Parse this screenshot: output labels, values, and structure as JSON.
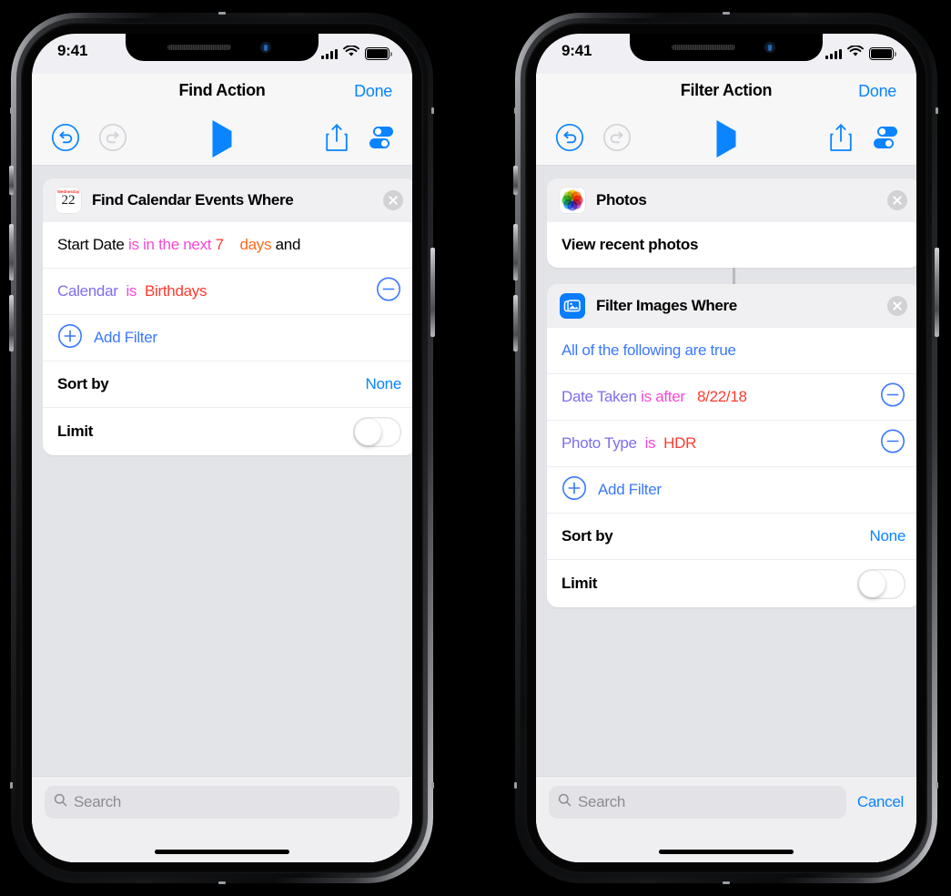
{
  "phones": [
    {
      "id": "find-action",
      "status_bar": {
        "time": "9:41",
        "cellular_icon": "signal-bars-icon",
        "wifi_icon": "wifi-icon",
        "battery_icon": "battery-icon"
      },
      "nav": {
        "title": "Find Action",
        "done_label": "Done"
      },
      "toolbar": {
        "undo_icon": "undo-icon",
        "redo_icon": "redo-icon",
        "play_icon": "play-icon",
        "share_icon": "share-icon",
        "settings_icon": "toggles-icon"
      },
      "cards": [
        {
          "icon": "calendar-app-icon",
          "icon_weekday": "Wednesday",
          "icon_day": "22",
          "title": "Find Calendar Events Where",
          "close_icon": "close-circle-icon",
          "rows": [
            {
              "type": "tokens",
              "tokens": [
                {
                  "text": "Start Date ",
                  "color": "black"
                },
                {
                  "text": "is in the next ",
                  "color": "magenta"
                },
                {
                  "text": "7",
                  "color": "red"
                },
                {
                  "text": "    ",
                  "color": "black"
                },
                {
                  "text": "days",
                  "color": "orange"
                },
                {
                  "text": " and",
                  "color": "black"
                }
              ],
              "minus": false
            },
            {
              "type": "tokens",
              "tokens": [
                {
                  "text": "Calendar",
                  "color": "purple"
                },
                {
                  "text": "  ",
                  "color": "black"
                },
                {
                  "text": "is",
                  "color": "magenta"
                },
                {
                  "text": "  ",
                  "color": "black"
                },
                {
                  "text": "Birthdays",
                  "color": "red"
                }
              ],
              "minus": true
            },
            {
              "type": "add",
              "label": "Add Filter",
              "icon": "plus-circle-icon"
            },
            {
              "type": "value",
              "label": "Sort by",
              "value": "None"
            },
            {
              "type": "toggle",
              "label": "Limit",
              "on": false
            }
          ]
        }
      ],
      "bottom": {
        "search_placeholder": "Search",
        "search_icon": "search-icon",
        "cancel_label": null
      }
    },
    {
      "id": "filter-action",
      "status_bar": {
        "time": "9:41",
        "cellular_icon": "signal-bars-icon",
        "wifi_icon": "wifi-icon",
        "battery_icon": "battery-icon"
      },
      "nav": {
        "title": "Filter Action",
        "done_label": "Done"
      },
      "toolbar": {
        "undo_icon": "undo-icon",
        "redo_icon": "redo-icon",
        "play_icon": "play-icon",
        "share_icon": "share-icon",
        "settings_icon": "toggles-icon"
      },
      "cards": [
        {
          "icon": "photos-app-icon",
          "title": "Photos",
          "close_icon": "close-circle-icon",
          "rows": [
            {
              "type": "plain",
              "label": "View recent photos"
            }
          ]
        },
        {
          "icon": "filter-images-icon",
          "title": "Filter Images Where",
          "close_icon": "close-circle-icon",
          "rows": [
            {
              "type": "tokens",
              "tokens": [
                {
                  "text": "All of the following are true",
                  "color": "blue"
                }
              ],
              "minus": false
            },
            {
              "type": "tokens",
              "tokens": [
                {
                  "text": "Date Taken ",
                  "color": "purple"
                },
                {
                  "text": "is after",
                  "color": "magenta"
                },
                {
                  "text": "   ",
                  "color": "black"
                },
                {
                  "text": "8/22/18",
                  "color": "red"
                }
              ],
              "minus": true
            },
            {
              "type": "tokens",
              "tokens": [
                {
                  "text": "Photo Type",
                  "color": "purple"
                },
                {
                  "text": "  ",
                  "color": "black"
                },
                {
                  "text": "is",
                  "color": "magenta"
                },
                {
                  "text": "  ",
                  "color": "black"
                },
                {
                  "text": "HDR",
                  "color": "red"
                }
              ],
              "minus": true
            },
            {
              "type": "add",
              "label": "Add Filter",
              "icon": "plus-circle-icon"
            },
            {
              "type": "value",
              "label": "Sort by",
              "value": "None"
            },
            {
              "type": "toggle",
              "label": "Limit",
              "on": false
            }
          ]
        }
      ],
      "bottom": {
        "search_placeholder": "Search",
        "search_icon": "search-icon",
        "cancel_label": "Cancel"
      }
    }
  ],
  "colors": {
    "accent_blue": "#0a84ff",
    "token_blue": "#3b78ff",
    "token_purple": "#7b6ef0",
    "token_magenta": "#f648d6",
    "token_red": "#ff3b30",
    "token_orange": "#ff6a18",
    "card_background": "#ffffff",
    "card_header": "#f0f0f3",
    "screen_background": "#e3e4e8"
  }
}
